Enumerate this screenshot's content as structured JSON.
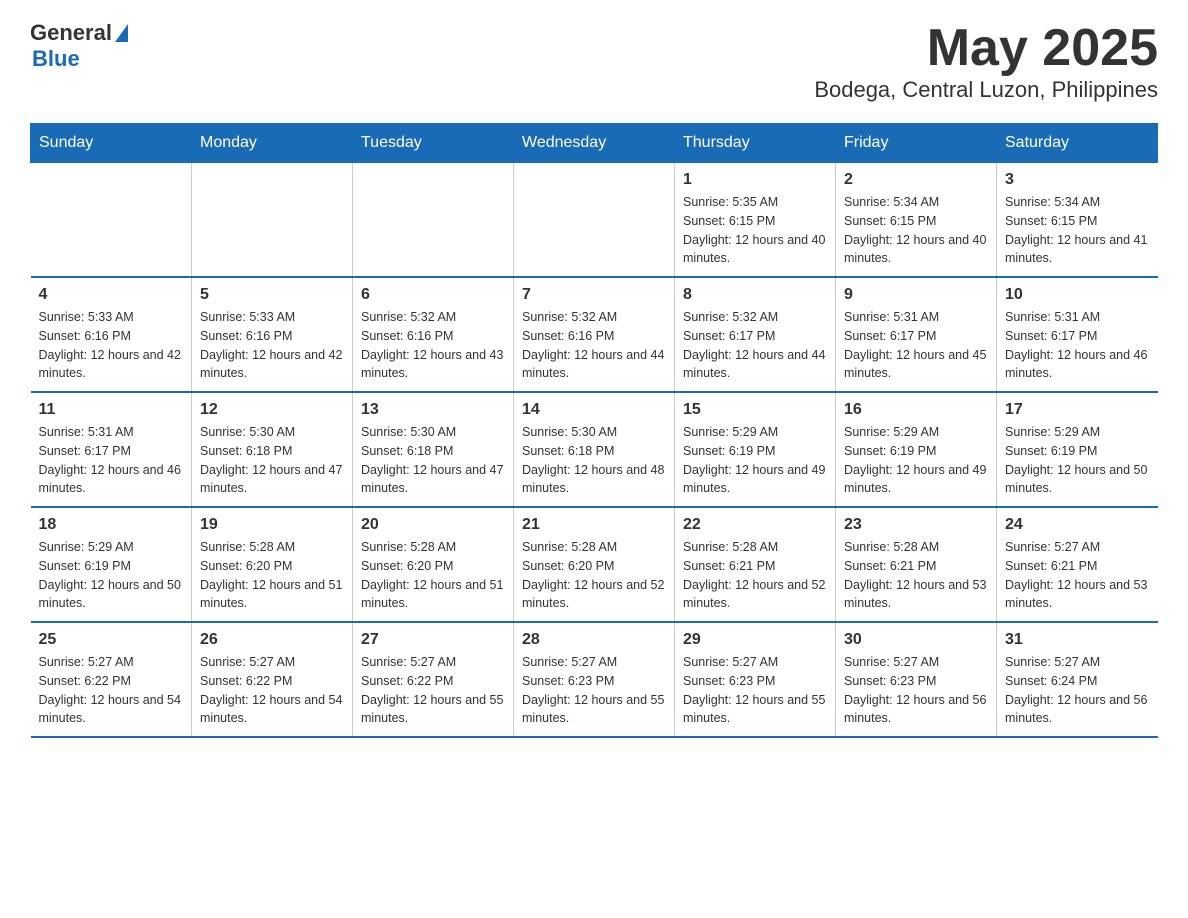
{
  "header": {
    "logo_general": "General",
    "logo_blue": "Blue",
    "title": "May 2025",
    "subtitle": "Bodega, Central Luzon, Philippines"
  },
  "days_of_week": [
    "Sunday",
    "Monday",
    "Tuesday",
    "Wednesday",
    "Thursday",
    "Friday",
    "Saturday"
  ],
  "weeks": [
    [
      {
        "day": "",
        "info": ""
      },
      {
        "day": "",
        "info": ""
      },
      {
        "day": "",
        "info": ""
      },
      {
        "day": "",
        "info": ""
      },
      {
        "day": "1",
        "info": "Sunrise: 5:35 AM\nSunset: 6:15 PM\nDaylight: 12 hours and 40 minutes."
      },
      {
        "day": "2",
        "info": "Sunrise: 5:34 AM\nSunset: 6:15 PM\nDaylight: 12 hours and 40 minutes."
      },
      {
        "day": "3",
        "info": "Sunrise: 5:34 AM\nSunset: 6:15 PM\nDaylight: 12 hours and 41 minutes."
      }
    ],
    [
      {
        "day": "4",
        "info": "Sunrise: 5:33 AM\nSunset: 6:16 PM\nDaylight: 12 hours and 42 minutes."
      },
      {
        "day": "5",
        "info": "Sunrise: 5:33 AM\nSunset: 6:16 PM\nDaylight: 12 hours and 42 minutes."
      },
      {
        "day": "6",
        "info": "Sunrise: 5:32 AM\nSunset: 6:16 PM\nDaylight: 12 hours and 43 minutes."
      },
      {
        "day": "7",
        "info": "Sunrise: 5:32 AM\nSunset: 6:16 PM\nDaylight: 12 hours and 44 minutes."
      },
      {
        "day": "8",
        "info": "Sunrise: 5:32 AM\nSunset: 6:17 PM\nDaylight: 12 hours and 44 minutes."
      },
      {
        "day": "9",
        "info": "Sunrise: 5:31 AM\nSunset: 6:17 PM\nDaylight: 12 hours and 45 minutes."
      },
      {
        "day": "10",
        "info": "Sunrise: 5:31 AM\nSunset: 6:17 PM\nDaylight: 12 hours and 46 minutes."
      }
    ],
    [
      {
        "day": "11",
        "info": "Sunrise: 5:31 AM\nSunset: 6:17 PM\nDaylight: 12 hours and 46 minutes."
      },
      {
        "day": "12",
        "info": "Sunrise: 5:30 AM\nSunset: 6:18 PM\nDaylight: 12 hours and 47 minutes."
      },
      {
        "day": "13",
        "info": "Sunrise: 5:30 AM\nSunset: 6:18 PM\nDaylight: 12 hours and 47 minutes."
      },
      {
        "day": "14",
        "info": "Sunrise: 5:30 AM\nSunset: 6:18 PM\nDaylight: 12 hours and 48 minutes."
      },
      {
        "day": "15",
        "info": "Sunrise: 5:29 AM\nSunset: 6:19 PM\nDaylight: 12 hours and 49 minutes."
      },
      {
        "day": "16",
        "info": "Sunrise: 5:29 AM\nSunset: 6:19 PM\nDaylight: 12 hours and 49 minutes."
      },
      {
        "day": "17",
        "info": "Sunrise: 5:29 AM\nSunset: 6:19 PM\nDaylight: 12 hours and 50 minutes."
      }
    ],
    [
      {
        "day": "18",
        "info": "Sunrise: 5:29 AM\nSunset: 6:19 PM\nDaylight: 12 hours and 50 minutes."
      },
      {
        "day": "19",
        "info": "Sunrise: 5:28 AM\nSunset: 6:20 PM\nDaylight: 12 hours and 51 minutes."
      },
      {
        "day": "20",
        "info": "Sunrise: 5:28 AM\nSunset: 6:20 PM\nDaylight: 12 hours and 51 minutes."
      },
      {
        "day": "21",
        "info": "Sunrise: 5:28 AM\nSunset: 6:20 PM\nDaylight: 12 hours and 52 minutes."
      },
      {
        "day": "22",
        "info": "Sunrise: 5:28 AM\nSunset: 6:21 PM\nDaylight: 12 hours and 52 minutes."
      },
      {
        "day": "23",
        "info": "Sunrise: 5:28 AM\nSunset: 6:21 PM\nDaylight: 12 hours and 53 minutes."
      },
      {
        "day": "24",
        "info": "Sunrise: 5:27 AM\nSunset: 6:21 PM\nDaylight: 12 hours and 53 minutes."
      }
    ],
    [
      {
        "day": "25",
        "info": "Sunrise: 5:27 AM\nSunset: 6:22 PM\nDaylight: 12 hours and 54 minutes."
      },
      {
        "day": "26",
        "info": "Sunrise: 5:27 AM\nSunset: 6:22 PM\nDaylight: 12 hours and 54 minutes."
      },
      {
        "day": "27",
        "info": "Sunrise: 5:27 AM\nSunset: 6:22 PM\nDaylight: 12 hours and 55 minutes."
      },
      {
        "day": "28",
        "info": "Sunrise: 5:27 AM\nSunset: 6:23 PM\nDaylight: 12 hours and 55 minutes."
      },
      {
        "day": "29",
        "info": "Sunrise: 5:27 AM\nSunset: 6:23 PM\nDaylight: 12 hours and 55 minutes."
      },
      {
        "day": "30",
        "info": "Sunrise: 5:27 AM\nSunset: 6:23 PM\nDaylight: 12 hours and 56 minutes."
      },
      {
        "day": "31",
        "info": "Sunrise: 5:27 AM\nSunset: 6:24 PM\nDaylight: 12 hours and 56 minutes."
      }
    ]
  ]
}
